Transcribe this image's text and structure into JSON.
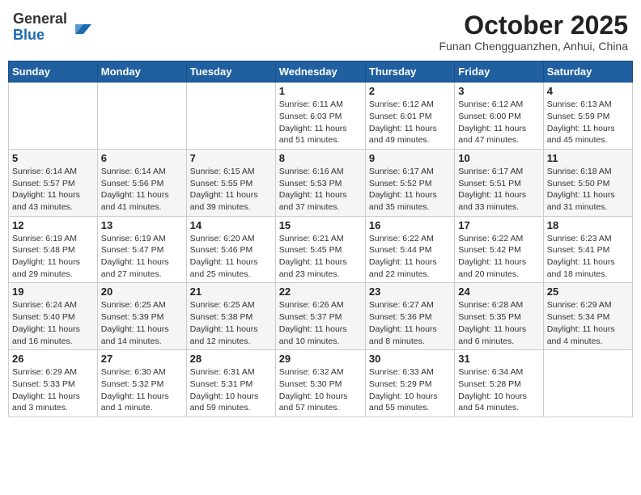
{
  "header": {
    "logo_general": "General",
    "logo_blue": "Blue",
    "title": "October 2025",
    "subtitle": "Funan Chengguanzhen, Anhui, China"
  },
  "weekdays": [
    "Sunday",
    "Monday",
    "Tuesday",
    "Wednesday",
    "Thursday",
    "Friday",
    "Saturday"
  ],
  "weeks": [
    [
      {
        "day": "",
        "info": ""
      },
      {
        "day": "",
        "info": ""
      },
      {
        "day": "",
        "info": ""
      },
      {
        "day": "1",
        "info": "Sunrise: 6:11 AM\nSunset: 6:03 PM\nDaylight: 11 hours\nand 51 minutes."
      },
      {
        "day": "2",
        "info": "Sunrise: 6:12 AM\nSunset: 6:01 PM\nDaylight: 11 hours\nand 49 minutes."
      },
      {
        "day": "3",
        "info": "Sunrise: 6:12 AM\nSunset: 6:00 PM\nDaylight: 11 hours\nand 47 minutes."
      },
      {
        "day": "4",
        "info": "Sunrise: 6:13 AM\nSunset: 5:59 PM\nDaylight: 11 hours\nand 45 minutes."
      }
    ],
    [
      {
        "day": "5",
        "info": "Sunrise: 6:14 AM\nSunset: 5:57 PM\nDaylight: 11 hours\nand 43 minutes."
      },
      {
        "day": "6",
        "info": "Sunrise: 6:14 AM\nSunset: 5:56 PM\nDaylight: 11 hours\nand 41 minutes."
      },
      {
        "day": "7",
        "info": "Sunrise: 6:15 AM\nSunset: 5:55 PM\nDaylight: 11 hours\nand 39 minutes."
      },
      {
        "day": "8",
        "info": "Sunrise: 6:16 AM\nSunset: 5:53 PM\nDaylight: 11 hours\nand 37 minutes."
      },
      {
        "day": "9",
        "info": "Sunrise: 6:17 AM\nSunset: 5:52 PM\nDaylight: 11 hours\nand 35 minutes."
      },
      {
        "day": "10",
        "info": "Sunrise: 6:17 AM\nSunset: 5:51 PM\nDaylight: 11 hours\nand 33 minutes."
      },
      {
        "day": "11",
        "info": "Sunrise: 6:18 AM\nSunset: 5:50 PM\nDaylight: 11 hours\nand 31 minutes."
      }
    ],
    [
      {
        "day": "12",
        "info": "Sunrise: 6:19 AM\nSunset: 5:48 PM\nDaylight: 11 hours\nand 29 minutes."
      },
      {
        "day": "13",
        "info": "Sunrise: 6:19 AM\nSunset: 5:47 PM\nDaylight: 11 hours\nand 27 minutes."
      },
      {
        "day": "14",
        "info": "Sunrise: 6:20 AM\nSunset: 5:46 PM\nDaylight: 11 hours\nand 25 minutes."
      },
      {
        "day": "15",
        "info": "Sunrise: 6:21 AM\nSunset: 5:45 PM\nDaylight: 11 hours\nand 23 minutes."
      },
      {
        "day": "16",
        "info": "Sunrise: 6:22 AM\nSunset: 5:44 PM\nDaylight: 11 hours\nand 22 minutes."
      },
      {
        "day": "17",
        "info": "Sunrise: 6:22 AM\nSunset: 5:42 PM\nDaylight: 11 hours\nand 20 minutes."
      },
      {
        "day": "18",
        "info": "Sunrise: 6:23 AM\nSunset: 5:41 PM\nDaylight: 11 hours\nand 18 minutes."
      }
    ],
    [
      {
        "day": "19",
        "info": "Sunrise: 6:24 AM\nSunset: 5:40 PM\nDaylight: 11 hours\nand 16 minutes."
      },
      {
        "day": "20",
        "info": "Sunrise: 6:25 AM\nSunset: 5:39 PM\nDaylight: 11 hours\nand 14 minutes."
      },
      {
        "day": "21",
        "info": "Sunrise: 6:25 AM\nSunset: 5:38 PM\nDaylight: 11 hours\nand 12 minutes."
      },
      {
        "day": "22",
        "info": "Sunrise: 6:26 AM\nSunset: 5:37 PM\nDaylight: 11 hours\nand 10 minutes."
      },
      {
        "day": "23",
        "info": "Sunrise: 6:27 AM\nSunset: 5:36 PM\nDaylight: 11 hours\nand 8 minutes."
      },
      {
        "day": "24",
        "info": "Sunrise: 6:28 AM\nSunset: 5:35 PM\nDaylight: 11 hours\nand 6 minutes."
      },
      {
        "day": "25",
        "info": "Sunrise: 6:29 AM\nSunset: 5:34 PM\nDaylight: 11 hours\nand 4 minutes."
      }
    ],
    [
      {
        "day": "26",
        "info": "Sunrise: 6:29 AM\nSunset: 5:33 PM\nDaylight: 11 hours\nand 3 minutes."
      },
      {
        "day": "27",
        "info": "Sunrise: 6:30 AM\nSunset: 5:32 PM\nDaylight: 11 hours\nand 1 minute."
      },
      {
        "day": "28",
        "info": "Sunrise: 6:31 AM\nSunset: 5:31 PM\nDaylight: 10 hours\nand 59 minutes."
      },
      {
        "day": "29",
        "info": "Sunrise: 6:32 AM\nSunset: 5:30 PM\nDaylight: 10 hours\nand 57 minutes."
      },
      {
        "day": "30",
        "info": "Sunrise: 6:33 AM\nSunset: 5:29 PM\nDaylight: 10 hours\nand 55 minutes."
      },
      {
        "day": "31",
        "info": "Sunrise: 6:34 AM\nSunset: 5:28 PM\nDaylight: 10 hours\nand 54 minutes."
      },
      {
        "day": "",
        "info": ""
      }
    ]
  ]
}
